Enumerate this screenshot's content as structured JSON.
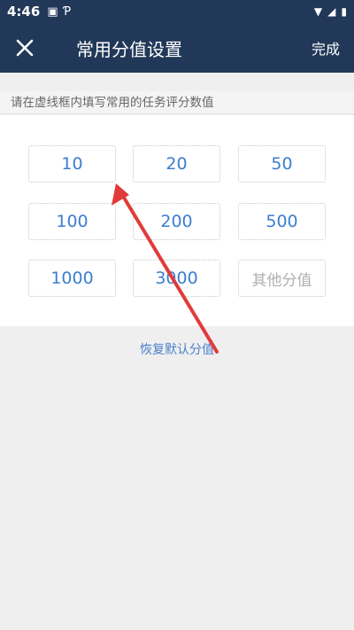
{
  "status_bar": {
    "time": "4:46"
  },
  "app_bar": {
    "title": "常用分值设置",
    "done_label": "完成"
  },
  "hint": "请在虚线框内填写常用的任务评分数值",
  "values": [
    "10",
    "20",
    "50",
    "100",
    "200",
    "500",
    "1000",
    "3000"
  ],
  "other_placeholder": "其他分值",
  "restore_label": "恢复默认分值",
  "colors": {
    "header": "#223858",
    "value_text": "#3b7ed0",
    "arrow": "#e23a3a"
  }
}
